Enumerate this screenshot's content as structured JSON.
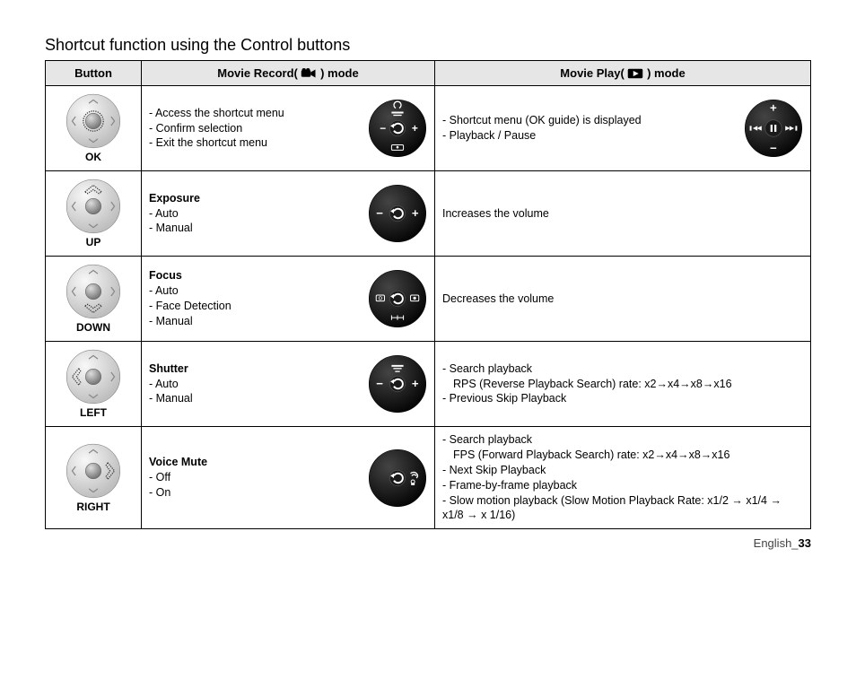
{
  "title": "Shortcut function using the Control buttons",
  "headers": {
    "button": "Button",
    "record_prefix": "Movie Record( ",
    "record_suffix": " ) mode",
    "play_prefix": "Movie Play( ",
    "play_suffix": " ) mode"
  },
  "rows": {
    "ok": {
      "label": "OK",
      "record": {
        "l1": "- Access the shortcut menu",
        "l2": "- Confirm selection",
        "l3": "- Exit the shortcut menu"
      },
      "play": {
        "l1": "- Shortcut menu (OK guide) is displayed",
        "l2": "- Playback / Pause"
      }
    },
    "up": {
      "label": "UP",
      "record": {
        "heading": "Exposure",
        "l1": "- Auto",
        "l2": "- Manual"
      },
      "play": {
        "l1": "Increases the volume"
      }
    },
    "down": {
      "label": "DOWN",
      "record": {
        "heading": "Focus",
        "l1": "- Auto",
        "l2": "- Face Detection",
        "l3": "- Manual"
      },
      "play": {
        "l1": "Decreases the volume"
      }
    },
    "left": {
      "label": "LEFT",
      "record": {
        "heading": "Shutter",
        "l1": "- Auto",
        "l2": "- Manual"
      },
      "play": {
        "d": "- ",
        "b1": "Search playback",
        "rps_b": "RPS",
        "rps_t": " (Reverse Playback Search) rate: x2→x4→x8→x16",
        "b2": "Previous Skip Playback"
      }
    },
    "right": {
      "label": "RIGHT",
      "record": {
        "heading": "Voice Mute",
        "l1": "- Off",
        "l2": "- On"
      },
      "play": {
        "d": "- ",
        "b1": "Search playback",
        "fps_b": "FPS",
        "fps_t": " (Forward Playback Search) rate: x2→x4→x8→x16",
        "b2": "Next Skip Playback",
        "b3": "Frame-by-frame playback",
        "b4": "Slow motion playback",
        "b4_t": " (Slow Motion Playback Rate: x1/2 → x1/4 → x1/8 → x 1/16)"
      }
    }
  },
  "footer": {
    "lang": "English_",
    "page": "33"
  }
}
